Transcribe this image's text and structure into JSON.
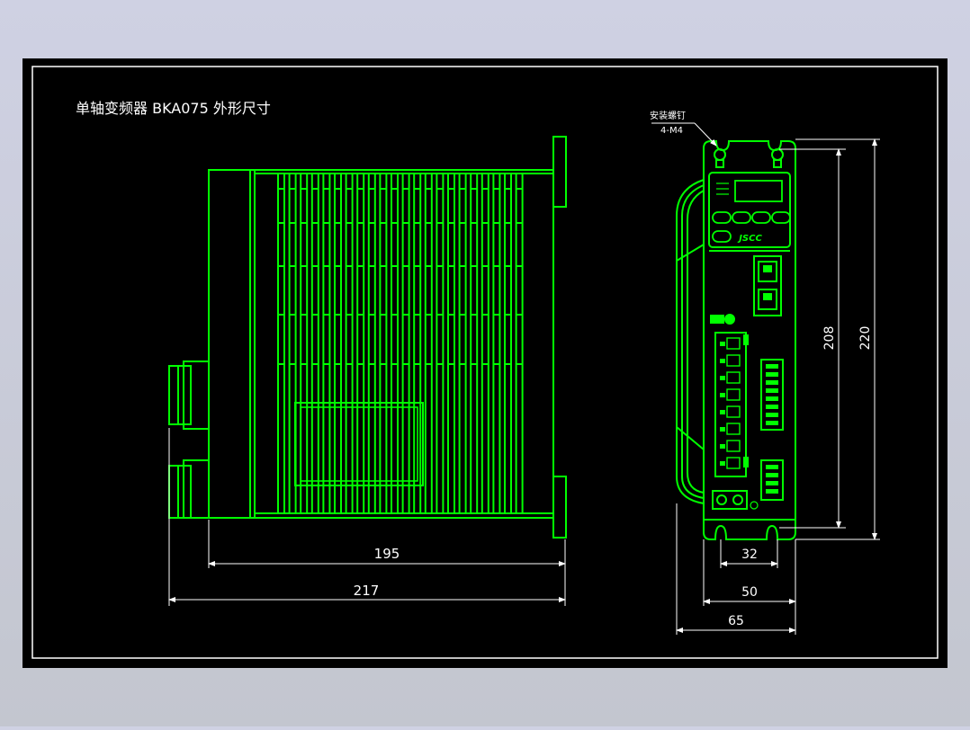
{
  "drawing": {
    "title": "单轴变频器 BKA075 外形尺寸",
    "colors": {
      "background": "#000000",
      "frame": "#ffffff",
      "outline": "#00ff00",
      "dimension": "#ffffff"
    },
    "side_view": {
      "dim_body_length": "195",
      "dim_total_length": "217"
    },
    "front_view": {
      "callout_line1": "安装螺钉",
      "callout_line2": "4-M4",
      "logo": "JSCC",
      "dim_hole_spacing_vertical": "208",
      "dim_height": "220",
      "dim_hole_spacing_horizontal": "32",
      "dim_width_front": "50",
      "dim_width_total": "65"
    }
  }
}
